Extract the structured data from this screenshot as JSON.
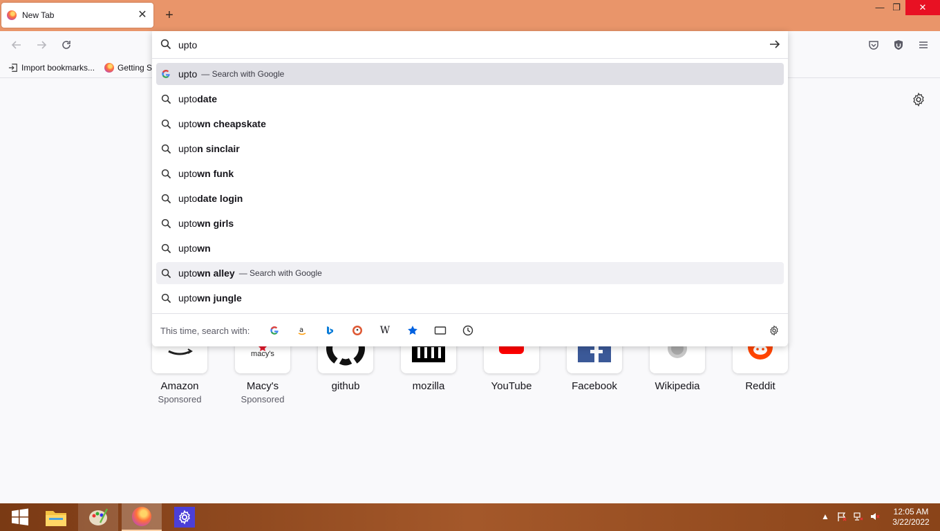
{
  "tab": {
    "title": "New Tab",
    "close": "✕"
  },
  "newtab_label": "+",
  "window": {
    "minimize": "—",
    "restore": "❐",
    "close": "✕"
  },
  "bookmarks": [
    {
      "label": "Import bookmarks..."
    },
    {
      "label": "Getting S"
    }
  ],
  "urlbar": {
    "value": "upto"
  },
  "suggestions": [
    {
      "prefix": "upto",
      "bold": "",
      "action": "— Search with Google",
      "icon": "google-icon",
      "state": "selected"
    },
    {
      "prefix": "upto",
      "bold": "date",
      "action": "",
      "icon": "search-icon",
      "state": ""
    },
    {
      "prefix": "upto",
      "bold": "wn cheapskate",
      "action": "",
      "icon": "search-icon",
      "state": ""
    },
    {
      "prefix": "upto",
      "bold": "n sinclair",
      "action": "",
      "icon": "search-icon",
      "state": ""
    },
    {
      "prefix": "upto",
      "bold": "wn funk",
      "action": "",
      "icon": "search-icon",
      "state": ""
    },
    {
      "prefix": "upto",
      "bold": "date login",
      "action": "",
      "icon": "search-icon",
      "state": ""
    },
    {
      "prefix": "upto",
      "bold": "wn girls",
      "action": "",
      "icon": "search-icon",
      "state": ""
    },
    {
      "prefix": "upto",
      "bold": "wn",
      "action": "",
      "icon": "search-icon",
      "state": ""
    },
    {
      "prefix": "upto",
      "bold": "wn alley",
      "action": "— Search with Google",
      "icon": "search-icon",
      "state": "hover"
    },
    {
      "prefix": "upto",
      "bold": "wn jungle",
      "action": "",
      "icon": "search-icon",
      "state": ""
    }
  ],
  "oneoff": {
    "label": "This time, search with:",
    "engines": [
      "google",
      "amazon",
      "bing",
      "duckduckgo",
      "wikipedia",
      "bookmarks",
      "tabs",
      "history"
    ],
    "wikipedia_glyph": "W"
  },
  "tiles": [
    {
      "name": "Amazon",
      "sponsored": "Sponsored",
      "icon": "amazon-icon"
    },
    {
      "name": "Macy's",
      "sponsored": "Sponsored",
      "icon": "macys-icon",
      "logo_text": "macy's"
    },
    {
      "name": "github",
      "sponsored": "",
      "icon": "github-icon"
    },
    {
      "name": "mozilla",
      "sponsored": "",
      "icon": "mozilla-icon"
    },
    {
      "name": "YouTube",
      "sponsored": "",
      "icon": "youtube-icon"
    },
    {
      "name": "Facebook",
      "sponsored": "",
      "icon": "facebook-icon"
    },
    {
      "name": "Wikipedia",
      "sponsored": "",
      "icon": "wikipedia-icon"
    },
    {
      "name": "Reddit",
      "sponsored": "",
      "icon": "reddit-icon"
    }
  ],
  "clock": {
    "time": "12:05 AM",
    "date": "3/22/2022"
  },
  "colors": {
    "titlebar": "#e9956a",
    "accent": "#0061e0",
    "taskbar": "#8a4419"
  }
}
